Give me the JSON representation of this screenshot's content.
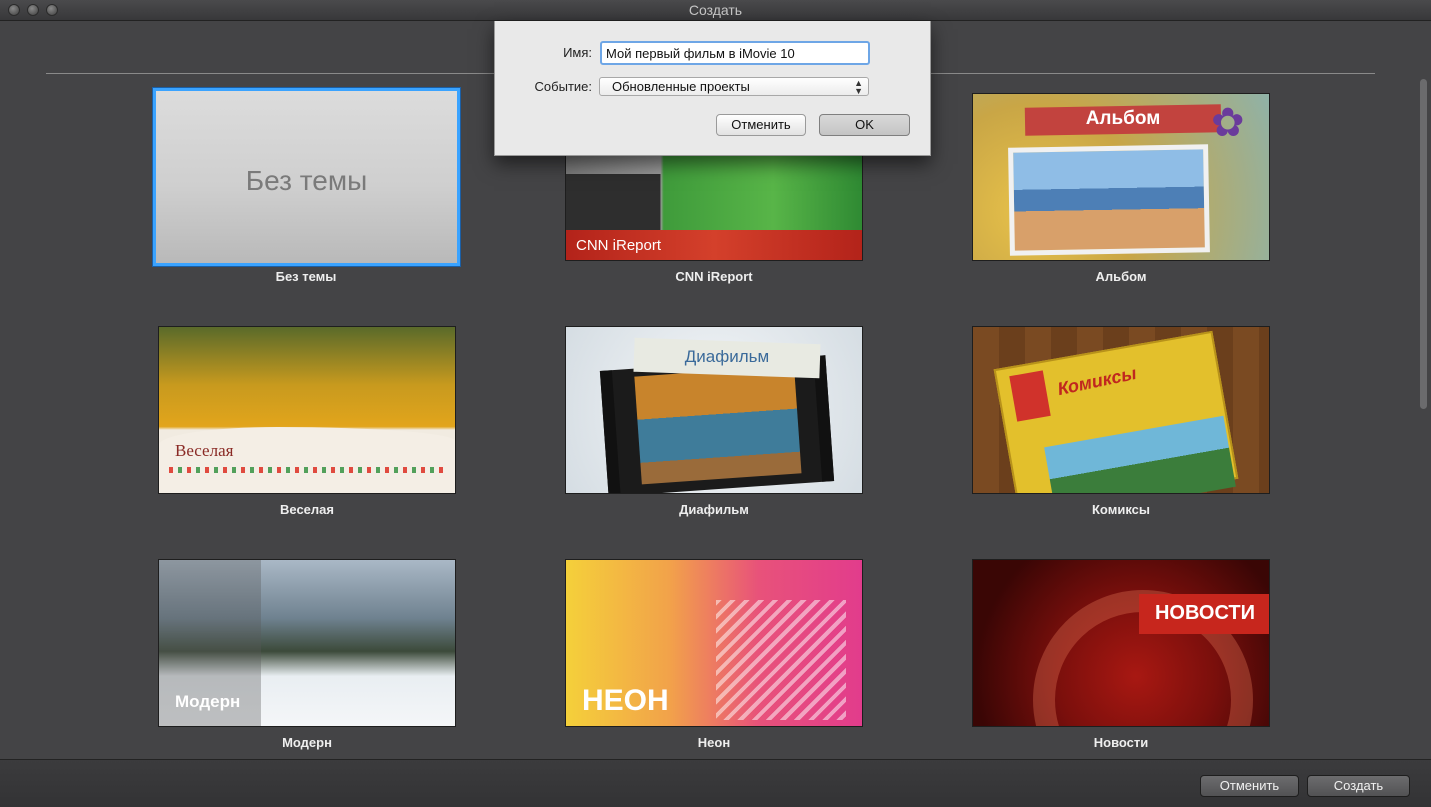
{
  "window": {
    "title": "Создать"
  },
  "themes": [
    {
      "thumb_text": "Без темы",
      "caption": "Без темы"
    },
    {
      "thumb_text": "CNN iReport",
      "caption": "CNN iReport"
    },
    {
      "thumb_text": "Альбом",
      "caption": "Альбом"
    },
    {
      "thumb_text": "Веселая",
      "caption": "Веселая"
    },
    {
      "thumb_text": "Диафильм",
      "caption": "Диафильм"
    },
    {
      "thumb_text": "Комиксы",
      "caption": "Комиксы"
    },
    {
      "thumb_text": "Модерн",
      "caption": "Модерн"
    },
    {
      "thumb_text": "НЕОН",
      "caption": "Неон"
    },
    {
      "thumb_text": "НОВОСТИ",
      "caption": "Новости"
    }
  ],
  "selected_theme": "Без темы",
  "dialog": {
    "name_label": "Имя:",
    "name_value": "Мой первый фильм в iMovie 10",
    "event_label": "Событие:",
    "event_value": "Обновленные проекты",
    "cancel_label": "Отменить",
    "ok_label": "OK"
  },
  "footer": {
    "cancel_label": "Отменить",
    "create_label": "Создать"
  },
  "colors": {
    "selection": "#3aa3ff",
    "background": "#444446"
  }
}
